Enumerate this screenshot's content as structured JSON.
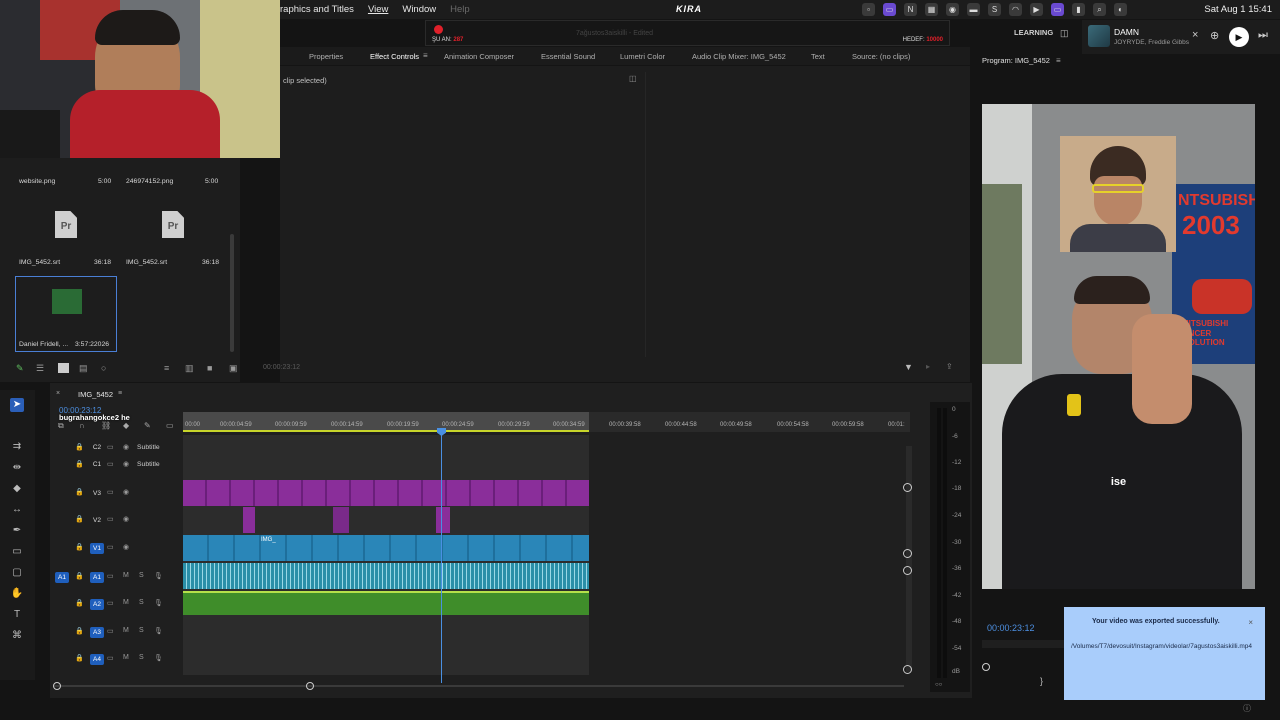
{
  "menubar": {
    "items": [
      "raphics and Titles",
      "View",
      "Window",
      "Help"
    ],
    "app_name": "KIRA",
    "clock": "Sat Aug 1  15:41"
  },
  "recording": {
    "now_label": "ŞU AN:",
    "now_value": "287",
    "goal_label": "HEDEF:",
    "goal_value": "10000"
  },
  "panel_tabs": [
    "Properties",
    "Effect Controls",
    "Animation Composer",
    "Essential Sound",
    "Lumetri Color",
    "Audio Clip Mixer: IMG_5452",
    "Text",
    "Source: (no clips)"
  ],
  "effect_controls": {
    "no_clip": "clip selected)",
    "timecode": "00:00:23:12"
  },
  "header_right": {
    "learning": "LEARNING",
    "program_title": "Program: IMG_5452"
  },
  "music": {
    "title": "DAMN",
    "artist": "JOYRYDE, Freddie Gibbs"
  },
  "program": {
    "caption": "ise",
    "poster_text": "NTSUBISH",
    "poster_year": "2003",
    "poster_sub": "MITSUBISHI",
    "poster_sub2": "LANCER EVOLUTION",
    "timecode": "00:00:23:12"
  },
  "toast": {
    "title": "Your video was exported successfully.",
    "path": "/Volumes/T7/devosuit/Instagram/videolar/7agustos3aiskilli.mp4",
    "close": "×"
  },
  "project": {
    "items": [
      {
        "name": "website.png",
        "duration": "5:00"
      },
      {
        "name": "246974152.png",
        "duration": "5:00"
      },
      {
        "name": "IMG_5452.srt",
        "duration": "36:18"
      },
      {
        "name": "IMG_5452.srt",
        "duration": "36:18"
      },
      {
        "name": "Daniel Fridell, ...",
        "duration": "3:57:22026"
      }
    ]
  },
  "timeline": {
    "sequence_name": "IMG_5452",
    "timecode": "00:00:23:12",
    "user_overlay": "bugrahangokce2  he",
    "ruler_ticks": [
      "00:00",
      "00:00:04:59",
      "00:00:09:59",
      "00:00:14:59",
      "00:00:19:59",
      "00:00:24:59",
      "00:00:29:59",
      "00:00:34:59",
      "00:00:39:58",
      "00:00:44:58",
      "00:00:49:58",
      "00:00:54:58",
      "00:00:59:58",
      "00:01:"
    ],
    "tracks": [
      {
        "label": "C2",
        "name": "Subtitle"
      },
      {
        "label": "C1",
        "name": "Subtitle"
      },
      {
        "label": "V3",
        "name": ""
      },
      {
        "label": "V2",
        "name": ""
      },
      {
        "label": "V1",
        "name": ""
      },
      {
        "label": "A1",
        "name": ""
      },
      {
        "label": "A2",
        "name": ""
      },
      {
        "label": "A3",
        "name": ""
      },
      {
        "label": "A4",
        "name": ""
      }
    ],
    "clip_label": "IMG_"
  },
  "meters": {
    "scale": [
      "0",
      "-6",
      "-12",
      "-18",
      "-24",
      "-30",
      "-36",
      "-42",
      "-48",
      "-54",
      "dB"
    ]
  }
}
